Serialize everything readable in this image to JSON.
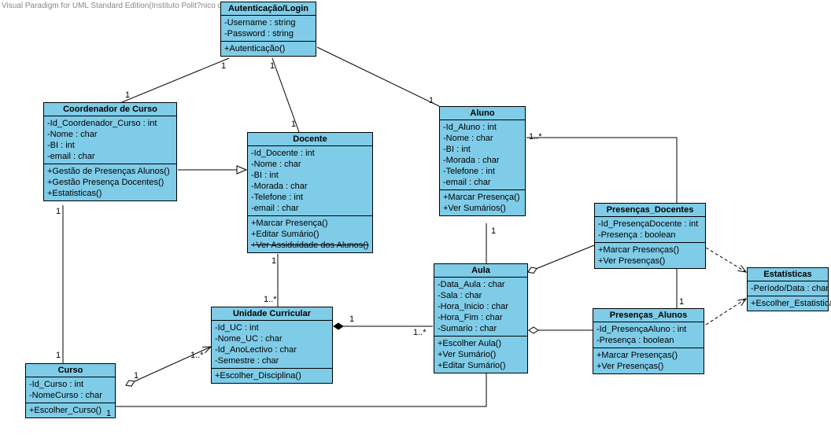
{
  "watermark": "Visual Paradigm for UML Standard Edition(Instituto Polit?nico de Beja)",
  "classes": {
    "auth": {
      "title": "Autenticação/Login",
      "attrs": [
        "-Username : string",
        "-Password : string"
      ],
      "ops": [
        "+Autenticação()"
      ]
    },
    "coord": {
      "title": "Coordenador de Curso",
      "attrs": [
        "-Id_Coordenador_Curso : int",
        "-Nome : char",
        "-BI : int",
        "-email : char"
      ],
      "ops": [
        "+Gestão de Presenças Alunos()",
        "+Gestão Presença Docentes()",
        "+Estatisticas()"
      ]
    },
    "docente": {
      "title": "Docente",
      "attrs": [
        "-Id_Docente : int",
        "-Nome : char",
        "-BI : int",
        "-Morada : char",
        "-Telefone : int",
        "-email : char"
      ],
      "ops": [
        "+Marcar Presença()",
        "+Editar Sumário()",
        "+Ver Assiduidade dos Alunos()"
      ]
    },
    "aluno": {
      "title": "Aluno",
      "attrs": [
        "-Id_Aluno : int",
        "-Nome : char",
        "-BI : int",
        "-Morada : char",
        "-Telefone : int",
        "-email : char"
      ],
      "ops": [
        "+Marcar Presença()",
        "+Ver Sumários()"
      ]
    },
    "pres_doc": {
      "title": "Presenças_Docentes",
      "attrs": [
        "-Id_PresençaDocente : int",
        "-Presença : boolean"
      ],
      "ops": [
        "+Marcar Presenças()",
        "+Ver Presenças()"
      ]
    },
    "aula": {
      "title": "Aula",
      "attrs": [
        "-Data_Aula : char",
        "-Sala : char",
        "-Hora_Inicio : char",
        "-Hora_Fim : char",
        "-Sumario : char"
      ],
      "ops": [
        "+Escolher Aula()",
        "+Ver Sumário()",
        "+Editar Sumário()"
      ]
    },
    "estat": {
      "title": "Estatísticas",
      "attrs": [
        "-Período/Data : char"
      ],
      "ops": [
        "+Escolher_Estatisticas()"
      ]
    },
    "uc": {
      "title": "Unidade Curricular",
      "attrs": [
        "-Id_UC : int",
        "-Nome_UC : char",
        "-Id_AnoLectivo : char",
        "-Semestre : char"
      ],
      "ops": [
        "+Escolher_Disciplina()"
      ]
    },
    "pres_al": {
      "title": "Presenças_Alunos",
      "attrs": [
        "-Id_PresençaAluno : int",
        "-Presença : boolean"
      ],
      "ops": [
        "+Marcar Presenças()",
        "+Ver Presenças()"
      ]
    },
    "curso": {
      "title": "Curso",
      "attrs": [
        "-Id_Curso : int",
        "-NomeCurso : char"
      ],
      "ops": [
        "+Escolher_Curso()"
      ]
    }
  },
  "mults": {
    "m1": "1",
    "m2": "1",
    "m3": "1",
    "m4": "1",
    "m5": "1",
    "m6": "1",
    "m7": "1",
    "m8": "1..*",
    "m9": "1",
    "m10": "1",
    "m11": "1",
    "m12": "1..*",
    "m13": "1",
    "m14": "1..*",
    "m15": "1..*",
    "m16": "1",
    "m17": "1"
  }
}
